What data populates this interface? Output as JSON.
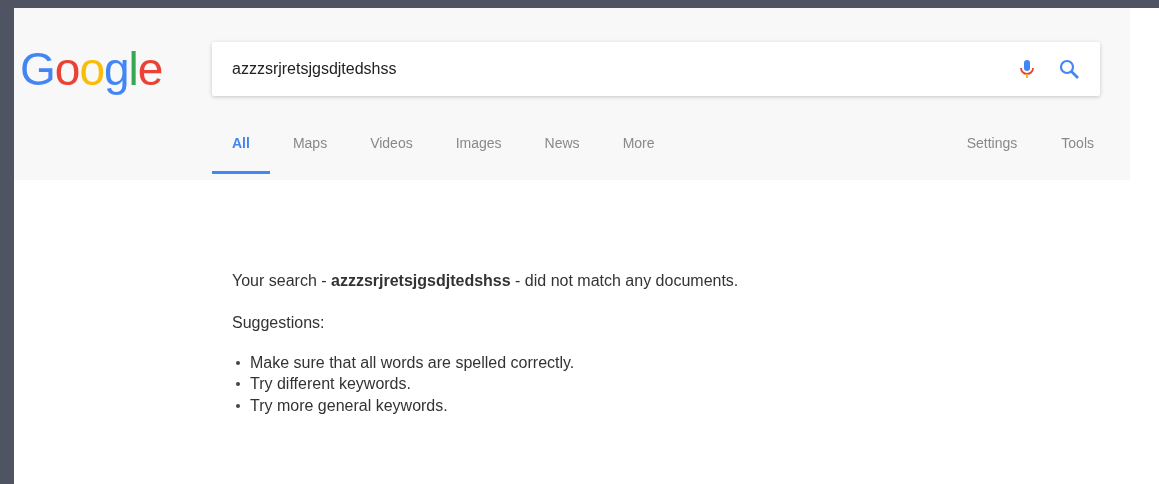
{
  "logo": [
    {
      "text": "G",
      "color": "#4285f4"
    },
    {
      "text": "o",
      "color": "#ea4335"
    },
    {
      "text": "o",
      "color": "#fbbc05"
    },
    {
      "text": "g",
      "color": "#4285f4"
    },
    {
      "text": "l",
      "color": "#34a853"
    },
    {
      "text": "e",
      "color": "#ea4335"
    }
  ],
  "search": {
    "value": "azzzsrjretsjgsdjtedshss"
  },
  "tabs": [
    {
      "label": "All",
      "selected": true
    },
    {
      "label": "Maps",
      "selected": false
    },
    {
      "label": "Videos",
      "selected": false
    },
    {
      "label": "Images",
      "selected": false
    },
    {
      "label": "News",
      "selected": false
    },
    {
      "label": "More",
      "selected": false
    }
  ],
  "tools": [
    "Settings",
    "Tools"
  ],
  "message": "Your search - **azzzsrjretsjgsdjtedshss** - did not match any documents.",
  "suggestions_title": "Suggestions:",
  "suggestions": [
    "Make sure that all words are spelled correctly.",
    "Try different keywords.",
    "Try more general keywords."
  ]
}
